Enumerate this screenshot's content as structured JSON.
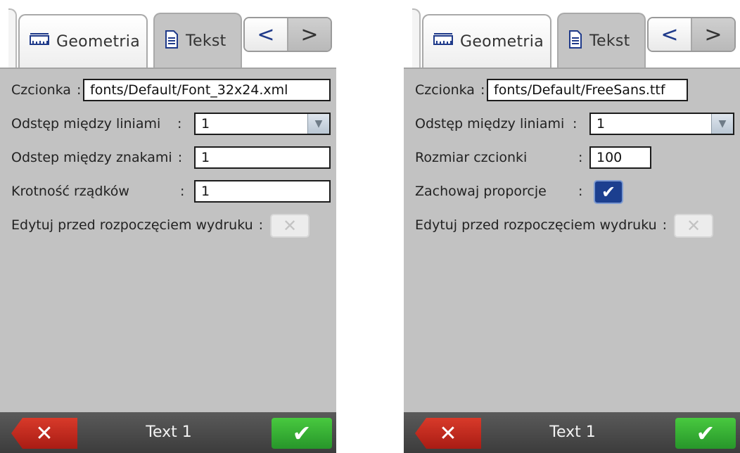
{
  "left": {
    "tabs": {
      "geometry": "Geometria",
      "text": "Tekst"
    },
    "nav": {
      "prev": "<",
      "next": ">"
    },
    "font": {
      "label": "Czcionka",
      "colon": ":",
      "value": "fonts/Default/Font_32x24.xml"
    },
    "line_spacing": {
      "label": "Odstęp między liniami",
      "colon": ":",
      "value": "1"
    },
    "char_spacing": {
      "label": "Odstep między znakami",
      "colon": ":",
      "value": "1"
    },
    "row_multiplicity": {
      "label": "Krotność rządków",
      "colon": ":",
      "value": "1"
    },
    "edit_before_print": {
      "label": "Edytuj przed rozpoczęciem wydruku",
      "colon": ":",
      "checked": false
    },
    "bottom": {
      "title": "Text 1"
    }
  },
  "right": {
    "tabs": {
      "geometry": "Geometria",
      "text": "Tekst"
    },
    "nav": {
      "prev": "<",
      "next": ">"
    },
    "font": {
      "label": "Czcionka",
      "colon": ":",
      "value": "fonts/Default/FreeSans.ttf"
    },
    "line_spacing": {
      "label": "Odstęp między liniami",
      "colon": ":",
      "value": "1"
    },
    "font_size": {
      "label": "Rozmiar czcionki",
      "colon": ":",
      "value": "100"
    },
    "keep_proportions": {
      "label": "Zachowaj proporcje",
      "colon": ":",
      "checked": true
    },
    "edit_before_print": {
      "label": "Edytuj przed rozpoczęciem wydruku",
      "colon": ":",
      "checked": false
    },
    "bottom": {
      "title": "Text 1"
    }
  },
  "colors": {
    "panel": "#c2c2c2",
    "cancel": "#c62c1f",
    "ok": "#3ab535",
    "checked": "#1c3f8f"
  },
  "icons": {
    "ruler": "ruler-icon",
    "document": "document-icon",
    "cancel": "x-icon",
    "ok": "check-icon"
  }
}
